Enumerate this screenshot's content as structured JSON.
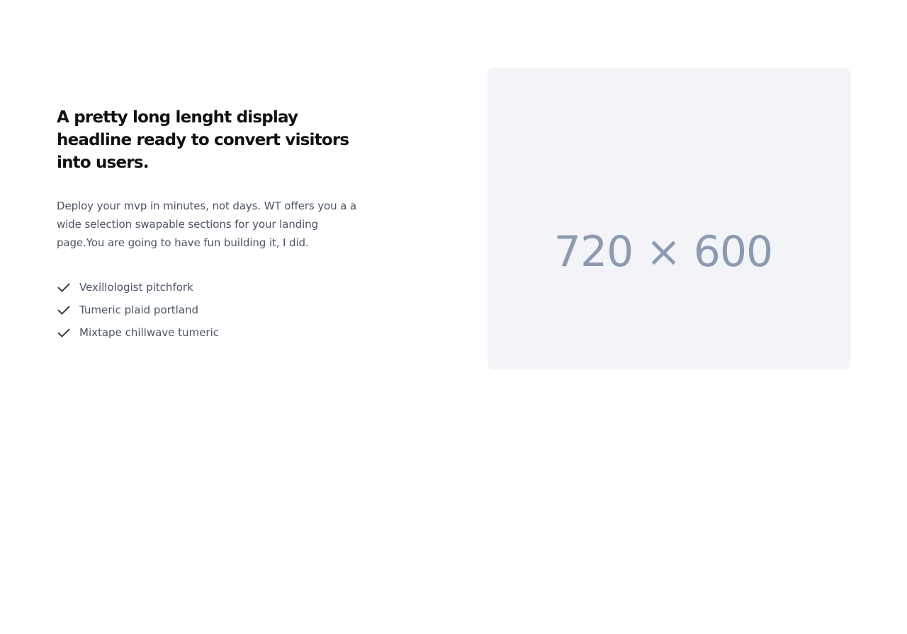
{
  "hero": {
    "headline": "A pretty long lenght display headline ready to convert visitors into users.",
    "description": "Deploy your mvp in minutes, not days. WT offers you a a wide selection swapable sections for your landing page.You are going to have fun building it, I did.",
    "features": [
      {
        "label": "Vexillologist pitchfork",
        "icon": "check-icon"
      },
      {
        "label": "Tumeric plaid portland",
        "icon": "check-icon"
      },
      {
        "label": "Mixtape chillwave tumeric",
        "icon": "check-icon"
      }
    ],
    "image_placeholder": {
      "label": "720 × 600"
    }
  },
  "colors": {
    "headline": "#111111",
    "body_text": "#4b5563",
    "placeholder_bg": "#f2f4f7",
    "placeholder_text": "#8c9ab2",
    "check_icon": "#374151"
  }
}
